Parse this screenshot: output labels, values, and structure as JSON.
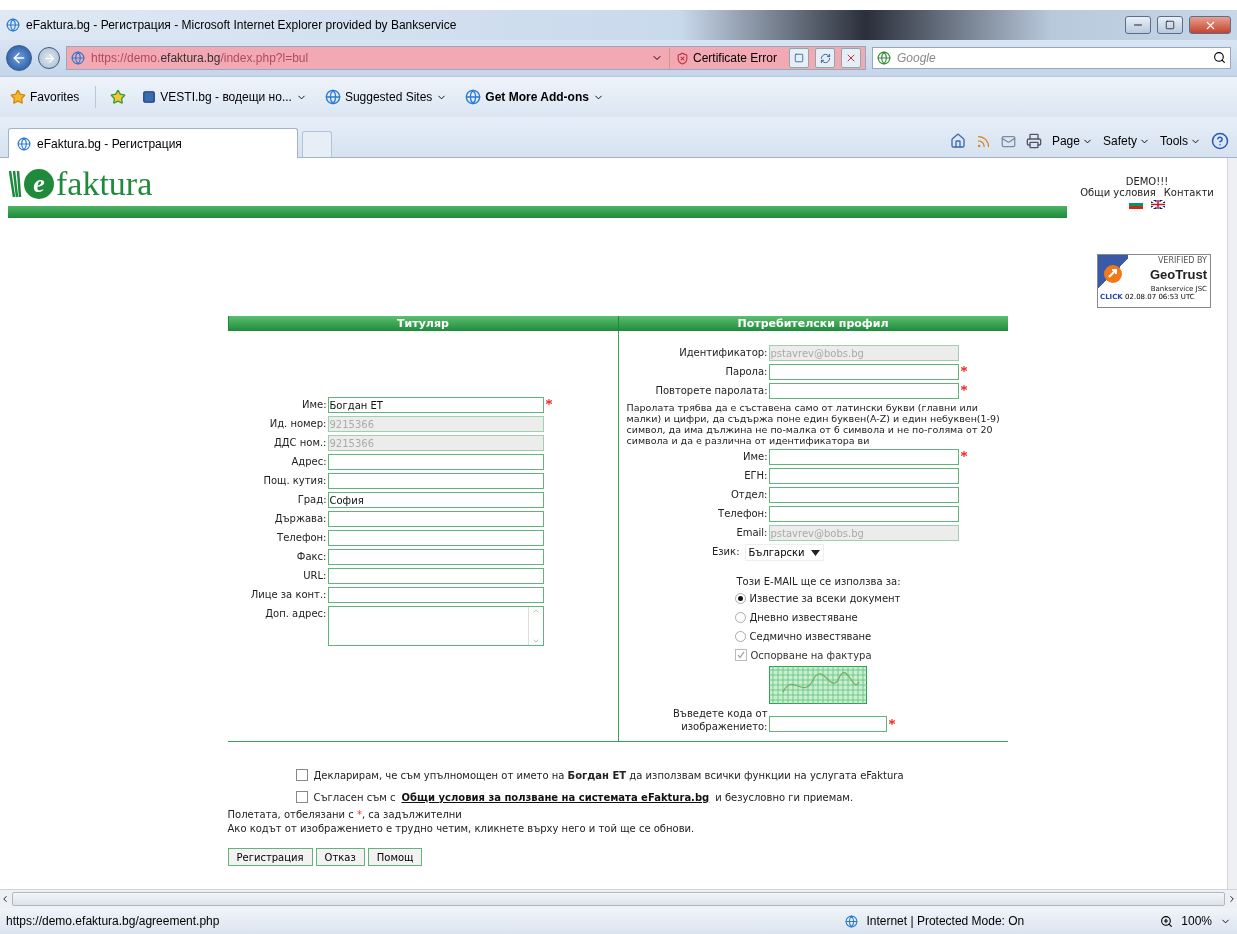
{
  "browser": {
    "title": "eFaktura.bg - Регистрация - Microsoft Internet Explorer provided by Bankservice",
    "address": "https://demo.**efaktura.bg**/index.php?l=bul",
    "certificate_error": "Certificate Error",
    "search_placeholder": "Google",
    "favorites": [
      {
        "label": "Favorites",
        "kind": "star",
        "menu": false,
        "bold": false
      },
      {
        "label": "VESTI.bg - водещи но...",
        "kind": "page",
        "menu": true,
        "bold": false
      },
      {
        "label": "Suggested Sites",
        "kind": "ie",
        "menu": true,
        "bold": false
      },
      {
        "label": "Get More Add-ons",
        "kind": "ie",
        "menu": true,
        "bold": true
      }
    ],
    "tab": "eFaktura.bg - Регистрация",
    "commands": [
      "Page",
      "Safety",
      "Tools"
    ]
  },
  "header": {
    "logo_mark": "e",
    "logo_text": "faktura",
    "demo": "DEMO!!!",
    "links": [
      "Общи условия",
      "Контакти"
    ],
    "seal": {
      "verified": "VERIFIED BY",
      "brand": "GeoTrust",
      "company": "Bankservice JSC",
      "click": "CLICK",
      "date": "02.08.07 06:53 UTC"
    }
  },
  "holder": {
    "title": "Титуляр",
    "fields": [
      {
        "kind": "text",
        "label": "Име:",
        "value": "Богдан ЕТ",
        "disabled": false,
        "required": true
      },
      {
        "kind": "text",
        "label": "Ид. номер:",
        "value": "9215366",
        "disabled": true,
        "required": false
      },
      {
        "kind": "text",
        "label": "ДДС ном.:",
        "value": "9215366",
        "disabled": true,
        "required": false
      },
      {
        "kind": "text",
        "label": "Адрес:",
        "disabled": false,
        "required": false
      },
      {
        "kind": "text",
        "label": "Пощ. кутия:",
        "disabled": false,
        "required": false
      },
      {
        "kind": "text",
        "label": "Град:",
        "value": "София",
        "disabled": false,
        "required": false
      },
      {
        "kind": "text",
        "label": "Държава:",
        "disabled": false,
        "required": false
      },
      {
        "kind": "text",
        "label": "Телефон:",
        "disabled": false,
        "required": false
      },
      {
        "kind": "text",
        "label": "Факс:",
        "disabled": false,
        "required": false
      },
      {
        "kind": "text",
        "label": "URL:",
        "disabled": false,
        "required": false
      },
      {
        "kind": "text",
        "label": "Лице за конт.:",
        "disabled": false,
        "required": false
      },
      {
        "kind": "textarea",
        "label": "Доп. адрес:",
        "disabled": false,
        "required": false
      }
    ]
  },
  "profile": {
    "title": "Потребителски профил",
    "rows": [
      {
        "kind": "text",
        "label": "Идентификатор:",
        "value": "pstavrev@bobs.bg",
        "disabled": true,
        "required": false
      },
      {
        "kind": "text",
        "label": "Парола:",
        "disabled": false,
        "required": true
      },
      {
        "kind": "text",
        "label": "Повторете паролата:",
        "disabled": false,
        "required": true
      },
      {
        "kind": "note",
        "text": "Паролата трябва да е съставена само от латински букви (главни или малки) и цифри, да съдържа поне един буквен(A-Z) и един небуквен(1-9) символ, да има дължина не по-малка от 6 символа и не по-голяма от 20 символа и да е различна от идентификатора ви"
      },
      {
        "kind": "text",
        "label": "Име:",
        "disabled": false,
        "required": true
      },
      {
        "kind": "text",
        "label": "ЕГН:",
        "disabled": false,
        "required": false
      },
      {
        "kind": "text",
        "label": "Отдел:",
        "disabled": false,
        "required": false
      },
      {
        "kind": "text",
        "label": "Телефон:",
        "disabled": false,
        "required": false
      },
      {
        "kind": "text",
        "label": "Email:",
        "value": "pstavrev@bobs.bg",
        "disabled": true,
        "required": false
      },
      {
        "kind": "select",
        "label": "Език:",
        "value": "Български"
      },
      {
        "kind": "heading",
        "text": "Този E-MAIL ще се използва за:"
      },
      {
        "kind": "radio",
        "label": "Известие за всеки документ",
        "selected": true
      },
      {
        "kind": "radio",
        "label": "Дневно известяване",
        "selected": false
      },
      {
        "kind": "radio",
        "label": "Седмично известяване",
        "selected": false
      },
      {
        "kind": "checkbox",
        "label": "Оспорване на фактура",
        "checked": true,
        "disabled": true
      },
      {
        "kind": "captcha"
      },
      {
        "kind": "code",
        "label": "Въведете кода от изображението:",
        "disabled": false,
        "required": true
      }
    ]
  },
  "declarations": [
    {
      "before": "Декларирам, че съм упълномощен от името на **Богдан ЕТ** да използвам всички функции на услугата eFaktura",
      "checked": false
    },
    {
      "before": "Съгласен съм с",
      "link": "Общи условия за ползване на системата eFaktura.bg",
      "after": "и безусловно ги приемам.",
      "checked": false
    }
  ],
  "required_note": {
    "before": "Полетата, отбелязани с ",
    "mark": "*",
    "after": ", са задължителни"
  },
  "captcha_hint": "Ако кодът от изображението е трудно четим, кликнете върху него и той ще се обнови.",
  "buttons": [
    "Регистрация",
    "Отказ",
    "Помощ"
  ],
  "status_bar": {
    "url": "https://demo.efaktura.bg/agreement.php",
    "zone": "Internet | Protected Mode: On",
    "zoom": "100%"
  }
}
